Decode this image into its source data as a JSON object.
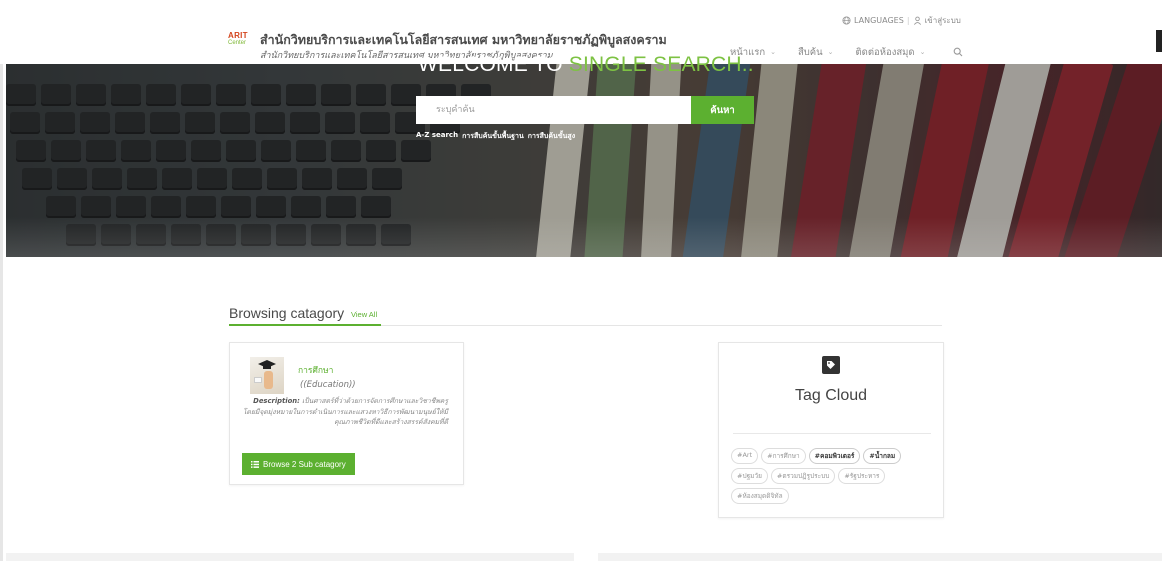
{
  "header": {
    "logo_text": "ARIT",
    "logo_sub": "Center",
    "site_title": "สำนักวิทยบริการและเทคโนโลยีสารสนเทศ มหาวิทยาลัยราชภัฏพิบูลสงคราม",
    "site_subtitle": "สำนักวิทยบริการและเทคโนโลยีสารสนเทศ มหาวิทยาลัยราชภัฏพิบูลสงคราม",
    "languages_label": "LANGUAGES",
    "separator": "|",
    "login_label": "เข้าสู่ระบบ",
    "nav": [
      {
        "label": "หน้าแรก",
        "icon": "chevron-down-icon"
      },
      {
        "label": "สืบค้น",
        "icon": "chevron-down-icon"
      },
      {
        "label": "ติดต่อห้องสมุด",
        "icon": "chevron-down-icon"
      }
    ],
    "nav_search_icon": "search-icon"
  },
  "hero": {
    "welcome_prefix": "WELCOME TO ",
    "welcome_accent": "SINGLE SEARCH..",
    "search_placeholder": "ระบุคำค้น",
    "search_button": "ค้นหา",
    "links": [
      "A-Z search",
      "การสืบค้นขั้นพื้นฐาน",
      "การสืบค้นขั้นสูง"
    ]
  },
  "browsing": {
    "title": "Browsing catagory",
    "view_all": "View All",
    "card": {
      "name": "การศึกษา",
      "english": "((Education))",
      "desc_label": "Description:",
      "desc_text": " เป็นศาสตร์ที่ว่าด้วยการจัดการศึกษาและวิชาชีพครู โดยมีจุดมุ่งหมายในการดำเนินการและแสวงหาวิธีการพัฒนามนุษย์ให้มีคุณภาพชีวิตที่ดีและสร้างสรรค์สังคมที่ดี",
      "button": "Browse 2 Sub catagory"
    }
  },
  "tag_cloud": {
    "title": "Tag Cloud",
    "tags": [
      {
        "label": "#Art",
        "hot": false
      },
      {
        "label": "#การศึกษา",
        "hot": false
      },
      {
        "label": "#คอมพิวเตอร์",
        "hot": true
      },
      {
        "label": "#น้ำกลม",
        "hot": true
      },
      {
        "label": "#ปฐมวัย",
        "hot": false
      },
      {
        "label": "#ตรวมปฏิรูประบบ",
        "hot": false
      },
      {
        "label": "#รัฐประหาร",
        "hot": false
      },
      {
        "label": "#ห้องสมุดดิจิทัล",
        "hot": false
      }
    ]
  },
  "colors": {
    "accent": "#5cb030",
    "title_accent": "#7dc243",
    "logo_red": "#d3441c"
  }
}
